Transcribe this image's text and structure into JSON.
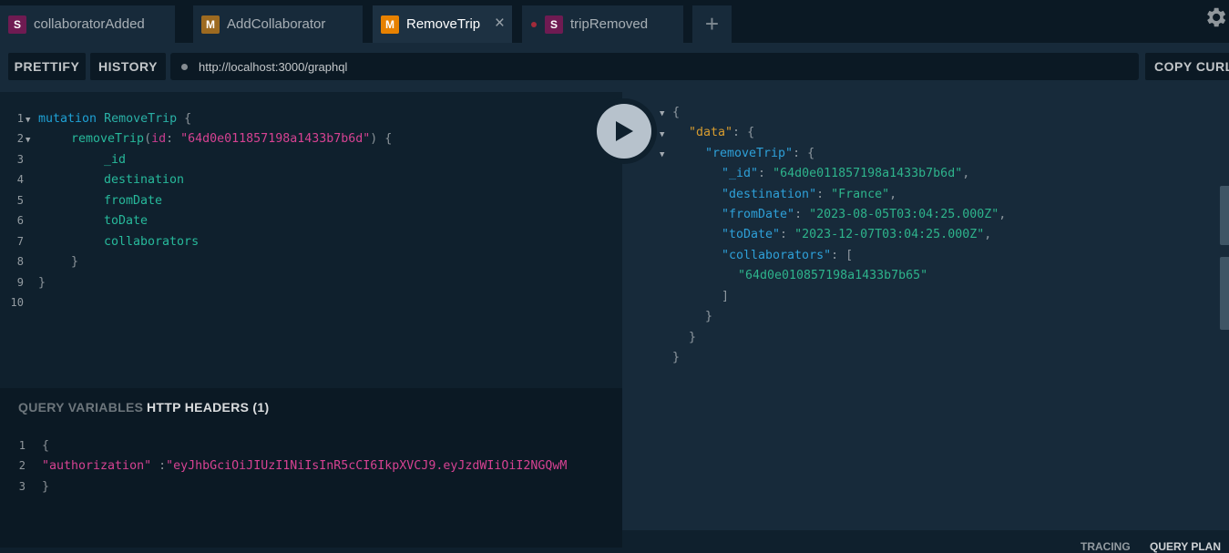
{
  "tabs": [
    {
      "badge": "S",
      "badge_color": "#6f1b52",
      "title": "collaboratorAdded"
    },
    {
      "badge": "M",
      "badge_color": "#9d6a20",
      "title": "AddCollaborator"
    },
    {
      "badge": "M",
      "badge_color": "#e78100",
      "title": "RemoveTrip",
      "active": true,
      "close": "×"
    },
    {
      "badge": "S",
      "badge_color": "#6f1b52",
      "title": "tripRemoved"
    }
  ],
  "new_tab_label": "+",
  "settings_icon": "gear-icon",
  "toolbar": {
    "prettify": "PRETTIFY",
    "history": "HISTORY",
    "url": "http://localhost:3000/graphql",
    "copy_curl": "COPY CURL"
  },
  "query": {
    "line_numbers": [
      "1",
      "2",
      "3",
      "4",
      "5",
      "6",
      "7",
      "8",
      "9",
      "10"
    ],
    "l1_keyword": "mutation",
    "l1_name": "RemoveTrip",
    "l1_brace": "{",
    "l2_field": "removeTrip",
    "l2_paren_open": "(",
    "l2_arg": "id",
    "l2_colon": ":",
    "l2_value": "\"64d0e011857198a1433b7b6d\"",
    "l2_paren_close": ")",
    "l2_brace": "{",
    "f3": "_id",
    "f4": "destination",
    "f5": "fromDate",
    "f6": "toDate",
    "f7": "collaborators",
    "l8": "}",
    "l9": "}"
  },
  "variables_panel": {
    "tab_query_variables": "QUERY VARIABLES",
    "tab_http_headers": "HTTP HEADERS (1)",
    "line_numbers": [
      "1",
      "2",
      "3"
    ],
    "open_brace": "{",
    "key": "\"authorization\"",
    "colon": ":",
    "value": "\"eyJhbGciOiJIUzI1NiIsInR5cCI6IkpXVCJ9.eyJzdWIiOiI2NGQwM",
    "close_brace": "}"
  },
  "response": {
    "open": "{",
    "data_key": "\"data\"",
    "remove_key": "\"removeTrip\"",
    "id_key": "\"_id\"",
    "id_val": "\"64d0e011857198a1433b7b6d\"",
    "dest_key": "\"destination\"",
    "dest_val": "\"France\"",
    "from_key": "\"fromDate\"",
    "from_val": "\"2023-08-05T03:04:25.000Z\"",
    "to_key": "\"toDate\"",
    "to_val": "\"2023-12-07T03:04:25.000Z\"",
    "collab_key": "\"collaborators\"",
    "collab_val": "\"64d0e010857198a1433b7b65\"",
    "colon": ":",
    "comma": ",",
    "brace_open": "{",
    "bracket_open": "[",
    "bracket_close": "]",
    "brace_close": "}"
  },
  "bottom": {
    "tracing": "TRACING",
    "query_plan": "QUERY PLAN"
  }
}
